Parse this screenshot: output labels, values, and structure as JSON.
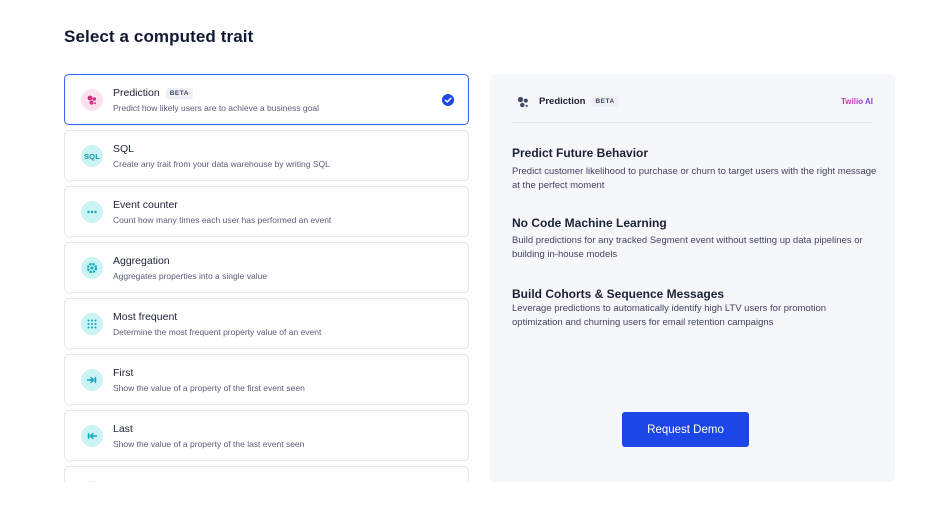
{
  "page": {
    "title": "Select a computed trait"
  },
  "traits": [
    {
      "name": "Prediction",
      "badge": "BETA",
      "description": "Predict how likely users are to achieve a business goal",
      "icon": "prediction-icon",
      "selected": true
    },
    {
      "name": "SQL",
      "description": "Create any trait from your data warehouse by writing SQL",
      "icon": "sql-icon",
      "icon_text": "SQL"
    },
    {
      "name": "Event counter",
      "description": "Count how many times each user has performed an event",
      "icon": "event-counter-icon"
    },
    {
      "name": "Aggregation",
      "description": "Aggregates properties into a single value",
      "icon": "aggregation-icon"
    },
    {
      "name": "Most frequent",
      "description": "Determine the most frequent property value of an event",
      "icon": "most-frequent-icon"
    },
    {
      "name": "First",
      "description": "Show the value of a property of the first event seen",
      "icon": "first-icon"
    },
    {
      "name": "Last",
      "description": "Show the value of a property of the last event seen",
      "icon": "last-icon"
    }
  ],
  "detail": {
    "title": "Prediction",
    "badge": "BETA",
    "brand": "Twilio AI",
    "features": [
      {
        "title": "Predict Future Behavior",
        "description": "Predict customer likelihood to purchase or churn to target users with the right message at the perfect moment"
      },
      {
        "title": "No Code Machine Learning",
        "description": "Build predictions for any tracked Segment event without setting up data pipelines or building in-house models"
      },
      {
        "title": "Build Cohorts & Sequence Messages",
        "description": "Leverage predictions to automatically identify high LTV users for promotion optimization and churning users for email retention campaigns"
      }
    ],
    "cta_label": "Request Demo"
  },
  "colors": {
    "accent": "#1c47e6",
    "selected_border": "#3b62f0",
    "icon_bg": "#c9f3f4",
    "prediction_icon_bg": "#fbe1ee"
  }
}
